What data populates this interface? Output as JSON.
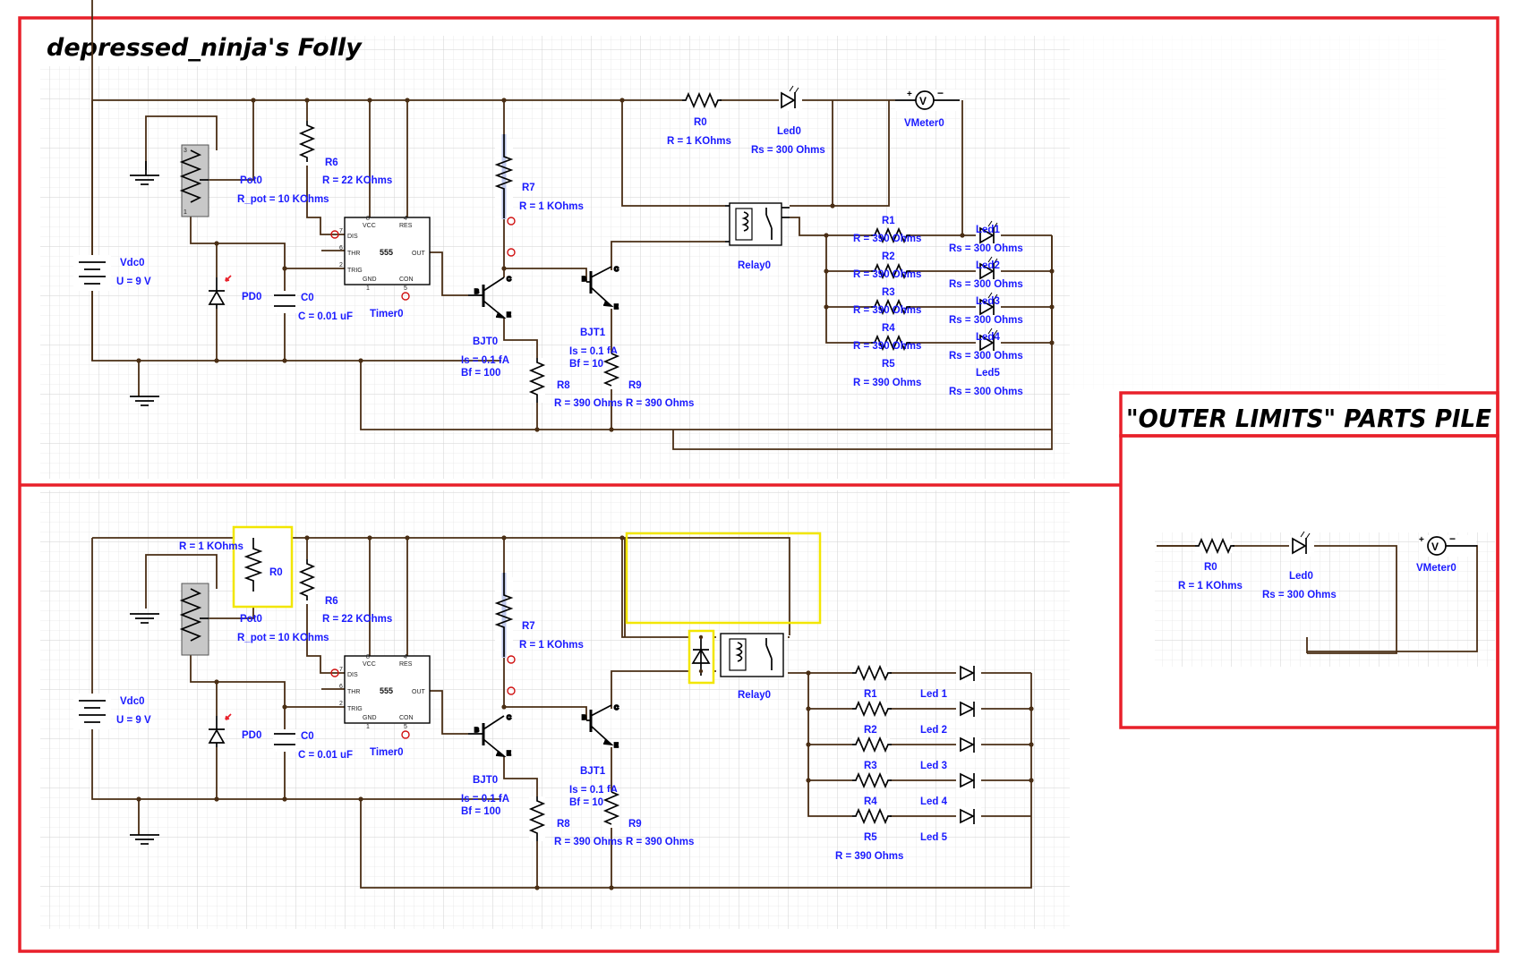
{
  "title": "depressed_ninja's Folly",
  "parts_pile_title": "\"OUTER LIMITS\" PARTS PILE",
  "top_circuit": {
    "vdc": {
      "name": "Vdc0",
      "value": "U = 9 V"
    },
    "pot": {
      "name": "Pot0",
      "value": "R_pot = 10 KOhms"
    },
    "pd": {
      "name": "PD0"
    },
    "c0": {
      "name": "C0",
      "value": "C = 0.01 uF"
    },
    "r6": {
      "name": "R6",
      "value": "R = 22 KOhms"
    },
    "timer": {
      "name": "Timer0",
      "chip": "555",
      "pins": {
        "vcc": "VCC",
        "res": "RES",
        "dis": "DIS",
        "thr": "THR",
        "trig": "TRIG",
        "out": "OUT",
        "gnd": "GND",
        "con": "CON"
      },
      "pin_numbers": {
        "vcc": "8",
        "res": "4",
        "dis": "7",
        "thr": "6",
        "trig": "2",
        "gnd": "1",
        "con": "5"
      }
    },
    "r7": {
      "name": "R7",
      "value": "R = 1 KOhms"
    },
    "bjt0": {
      "name": "BJT0",
      "is": "Is = 0.1 fA",
      "bf": "Bf = 100"
    },
    "bjt1": {
      "name": "BJT1",
      "is": "Is = 0.1 fA",
      "bf": "Bf = 100"
    },
    "r8": {
      "name": "R8",
      "value": "R = 390 Ohms"
    },
    "r9": {
      "name": "R9",
      "value": "R = 390 Ohms"
    },
    "r0": {
      "name": "R0",
      "value": "R = 1 KOhms"
    },
    "led0": {
      "name": "Led0",
      "value": "Rs = 300 Ohms"
    },
    "vmeter": {
      "name": "VMeter0"
    },
    "relay": {
      "name": "Relay0"
    },
    "resistors": [
      {
        "name": "R1",
        "value": "R = 390 Ohms"
      },
      {
        "name": "R2",
        "value": "R = 390 Ohms"
      },
      {
        "name": "R3",
        "value": "R = 390 Ohms"
      },
      {
        "name": "R4",
        "value": "R = 390 Ohms"
      },
      {
        "name": "R5",
        "value": "R = 390 Ohms"
      }
    ],
    "leds": [
      {
        "name": "Led1",
        "value": "Rs = 300 Ohms"
      },
      {
        "name": "Led2",
        "value": "Rs = 300 Ohms"
      },
      {
        "name": "Led3",
        "value": "Rs = 300 Ohms"
      },
      {
        "name": "Led4",
        "value": "Rs = 300 Ohms"
      },
      {
        "name": "Led5",
        "value": "Rs = 300 Ohms"
      }
    ]
  },
  "bottom_circuit": {
    "r0": {
      "name": "R0",
      "value": "R = 1 KOhms"
    },
    "resistors": [
      "R1",
      "R2",
      "R3",
      "R4",
      "R5"
    ],
    "r5_value": "R = 390 Ohms",
    "leds": [
      "Led 1",
      "Led 2",
      "Led 3",
      "Led 4",
      "Led 5"
    ]
  },
  "parts_pile": {
    "r0": {
      "name": "R0",
      "value": "R = 1 KOhms"
    },
    "led0": {
      "name": "Led0",
      "value": "Rs = 300 Ohms"
    },
    "vmeter": {
      "name": "VMeter0"
    }
  },
  "colors": {
    "frame": "#e8202a",
    "wire": "#4a2e14",
    "label": "#1a1aff",
    "highlight": "#f2e600",
    "grid": "#e3e3e3"
  }
}
